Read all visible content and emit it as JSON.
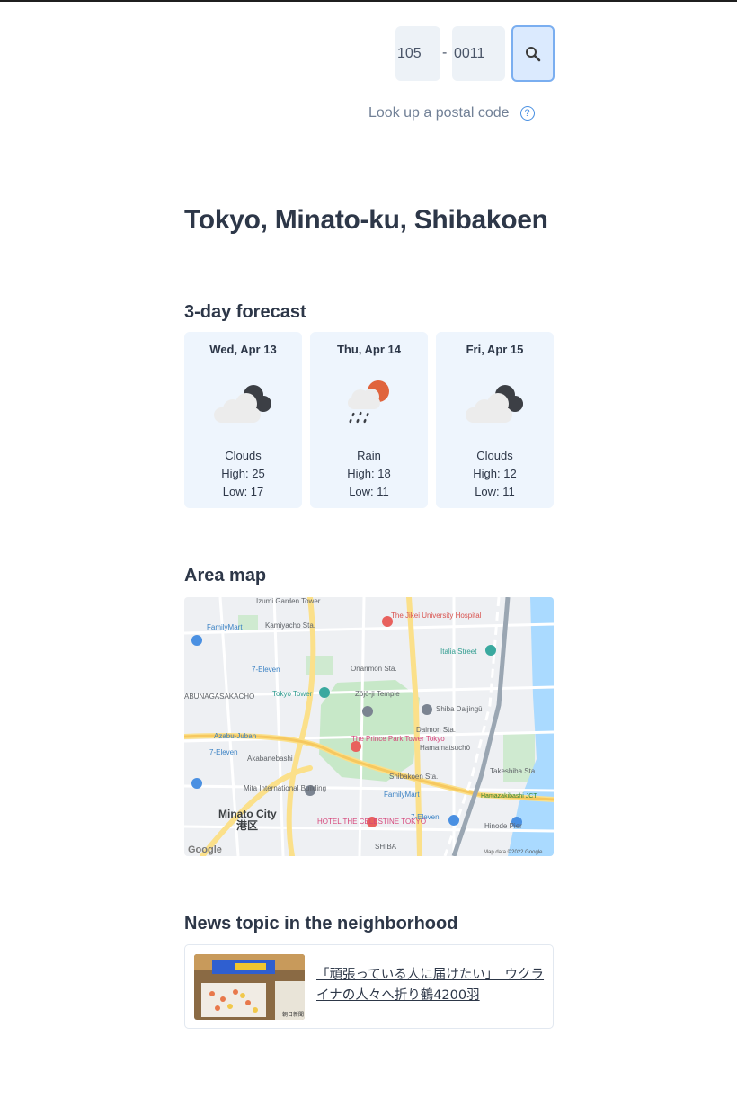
{
  "postal": {
    "first_value": "105",
    "separator": "-",
    "second_value": "0011",
    "search_icon": "magnifier-icon",
    "lookup_label": "Look up a postal code",
    "help_icon": "question-circle-icon",
    "help_glyph": "?"
  },
  "location": {
    "title": "Tokyo, Minato-ku, Shibakoen"
  },
  "forecast": {
    "title": "3-day forecast",
    "days": [
      {
        "date": "Wed, Apr 13",
        "icon": "clouds-icon",
        "condition": "Clouds",
        "high": "High: 25",
        "low": "Low: 17"
      },
      {
        "date": "Thu, Apr 14",
        "icon": "rain-icon",
        "condition": "Rain",
        "high": "High: 18",
        "low": "Low: 11"
      },
      {
        "date": "Fri, Apr 15",
        "icon": "clouds-icon",
        "condition": "Clouds",
        "high": "High: 12",
        "low": "Low: 11"
      }
    ]
  },
  "map": {
    "title": "Area map",
    "labels": {
      "izumi": "Izumi Garden Tower",
      "jikei": "The Jikei University Hospital",
      "familymart1": "FamilyMart",
      "kamiyacho": "Kamiyacho Sta.",
      "italia": "Italia Street",
      "eleven1": "7-Eleven",
      "onarimon": "Onarimon Sta.",
      "abuna": "ABUNAGASAKACHO",
      "tower": "Tokyo Tower",
      "zojoji": "Zōjō-ji Temple",
      "daijingu": "Shiba Daijingū",
      "azabu": "Azabu-Juban",
      "daimon": "Daimon Sta.",
      "eleven2": "7-Eleven",
      "prince": "The Prince Park Tower Tokyo",
      "hamamatsucho": "Hamamatsuchō",
      "akabanebashi": "Akabanebashi",
      "takeshiba": "Takeshiba Sta.",
      "shibakoen": "Shibakoen Sta.",
      "mita": "Mita International Building",
      "familymart2": "FamilyMart",
      "jct": "Hamazakibashi JCT",
      "minato": "Minato City",
      "minato_jp": "港区",
      "celestine": "HOTEL THE CELESTINE TOKYO",
      "eleven3": "7-Eleven",
      "hinode": "Hinode Pier",
      "shiba": "SHIBA",
      "google": "Google",
      "mapdata": "Map data ©2022 Google"
    }
  },
  "news": {
    "title": "News topic in the neighborhood",
    "headline": "「頑張っている人に届けたい」　ウクライナの人々へ折り鶴4200羽",
    "thumb_caption": "朝日新聞"
  },
  "colors": {
    "text": "#2d3748",
    "card_bg": "#eef5fd",
    "accent": "#4a90e2",
    "search_bg": "#dbeafe"
  }
}
